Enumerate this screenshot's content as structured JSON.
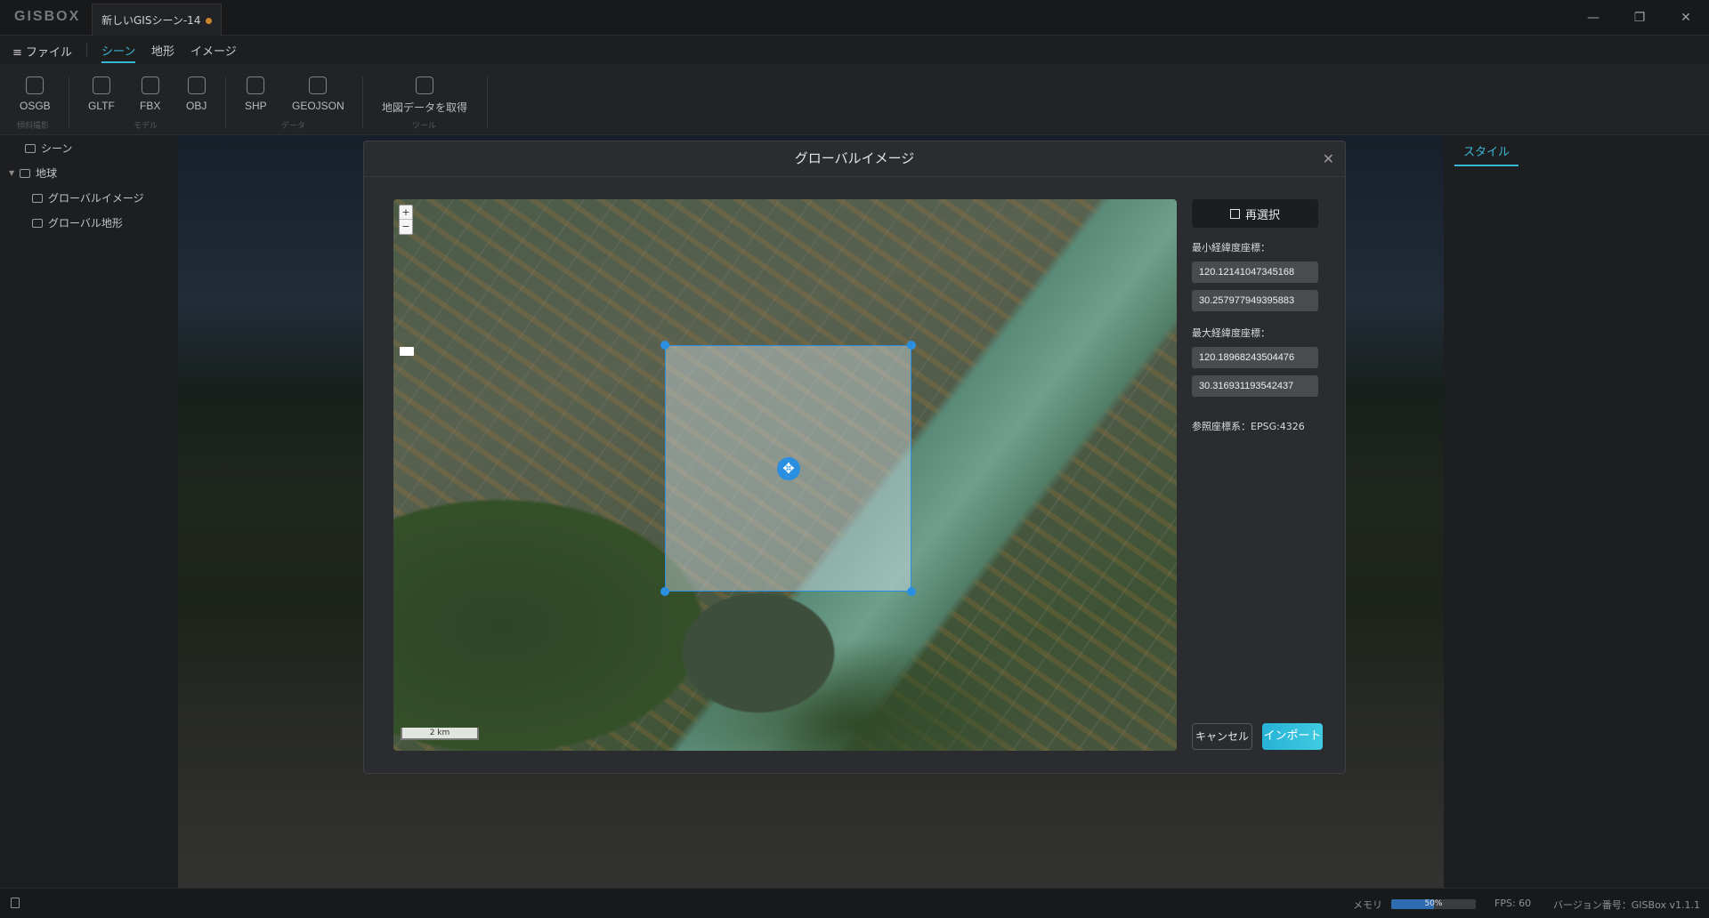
{
  "app": {
    "logo": "GISBOX",
    "doc_tab": "新しいGISシーン-14"
  },
  "window_controls": {
    "minimize": "—",
    "restore": "❐",
    "close": "✕"
  },
  "menu": {
    "file": "≡ ファイル",
    "tabs": [
      "シーン",
      "地形",
      "イメージ"
    ],
    "active_tab": "シーン"
  },
  "ribbon": {
    "buttons": [
      {
        "label": "OSGB",
        "icon": "osgb-icon"
      },
      {
        "label": "GLTF",
        "icon": "gltf-icon"
      },
      {
        "label": "FBX",
        "icon": "fbx-icon"
      },
      {
        "label": "OBJ",
        "icon": "obj-icon"
      },
      {
        "label": "SHP",
        "icon": "shp-icon"
      },
      {
        "label": "GEOJSON",
        "icon": "geojson-icon"
      },
      {
        "label": "地図データを取得",
        "icon": "map-data-icon"
      }
    ],
    "groups": [
      "傾斜撮影",
      "モデル",
      "データ",
      "ツール"
    ]
  },
  "tree": {
    "items": [
      {
        "label": "シーン",
        "icon": "scene-icon"
      },
      {
        "label": "地球",
        "icon": "globe-icon"
      },
      {
        "label": "グローバルイメージ",
        "icon": "image-icon"
      },
      {
        "label": "グローバル地形",
        "icon": "terrain-icon"
      }
    ]
  },
  "right_panel": {
    "tab": "スタイル"
  },
  "modal": {
    "title": "グローバルイメージ",
    "close": "✕",
    "reselect": "再選択",
    "min_label": "最小経緯度座標：",
    "min_lon": "120.12141047345168",
    "min_lat": "30.257977949395883",
    "max_label": "最大経緯度座標：",
    "max_lon": "120.18968243504476",
    "max_lat": "30.316931193542437",
    "crs": "参照座標系：EPSG:4326",
    "cancel": "キャンセル",
    "import": "インポート",
    "map": {
      "zoom_in": "+",
      "zoom_out": "−",
      "scale": "2 km",
      "move": "✥"
    }
  },
  "status": {
    "memory_label": "メモリ",
    "memory_percent": "50%",
    "memory_fraction": 0.5,
    "fps": "FPS: 60",
    "version": "バージョン番号：GISBox v1.1.1"
  },
  "colors": {
    "accent": "#39b7d6",
    "selection": "#2a8fe0",
    "import_button": "#27b2d6"
  }
}
